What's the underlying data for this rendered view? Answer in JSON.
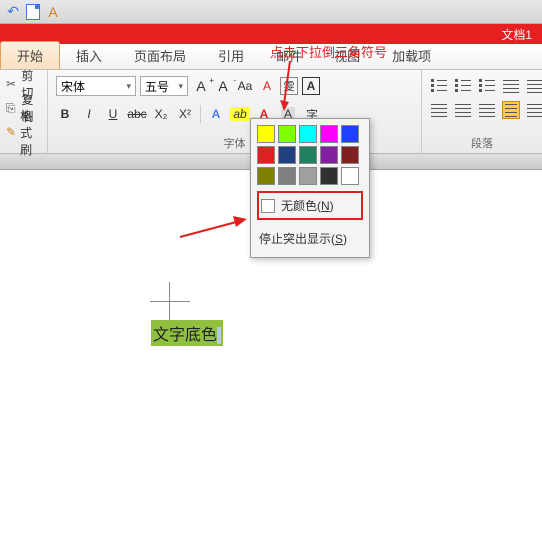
{
  "title": "文档1",
  "tabs": [
    "开始",
    "插入",
    "页面布局",
    "引用",
    "邮件",
    "视图",
    "加载项"
  ],
  "clip": {
    "cut": "剪切",
    "copy": "复制",
    "fmt": "格式刷"
  },
  "font": {
    "name": "宋体",
    "size": "五号",
    "group_label": "字体",
    "bold": "B",
    "italic": "I",
    "underline": "U",
    "strike": "abc",
    "sub": "X₂",
    "sup": "X²",
    "grow": "A",
    "shrink": "A",
    "case": "Aa",
    "clear": "A",
    "wen": "雯",
    "charbox": "A",
    "highlight": "ab",
    "fontcolor": "A",
    "border": "A",
    "shade": "字"
  },
  "para": {
    "group_label": "段落"
  },
  "color_menu": {
    "no_color_pre": "无颜色(",
    "no_color_u": "N",
    "no_color_post": ")",
    "stop_pre": "停止突出显示(",
    "stop_u": "S",
    "stop_post": ")"
  },
  "annotation": "点击下拉倒三角符号",
  "sample": "文字底色",
  "colors": [
    "#ffff00",
    "#80ff00",
    "#00ffff",
    "#ff00ff",
    "#2040ff",
    "#e02020",
    "#204080",
    "#208060",
    "#8020a0",
    "#802020",
    "#808000",
    "#808080",
    "#a0a0a0",
    "#303030",
    "#ffffff"
  ]
}
